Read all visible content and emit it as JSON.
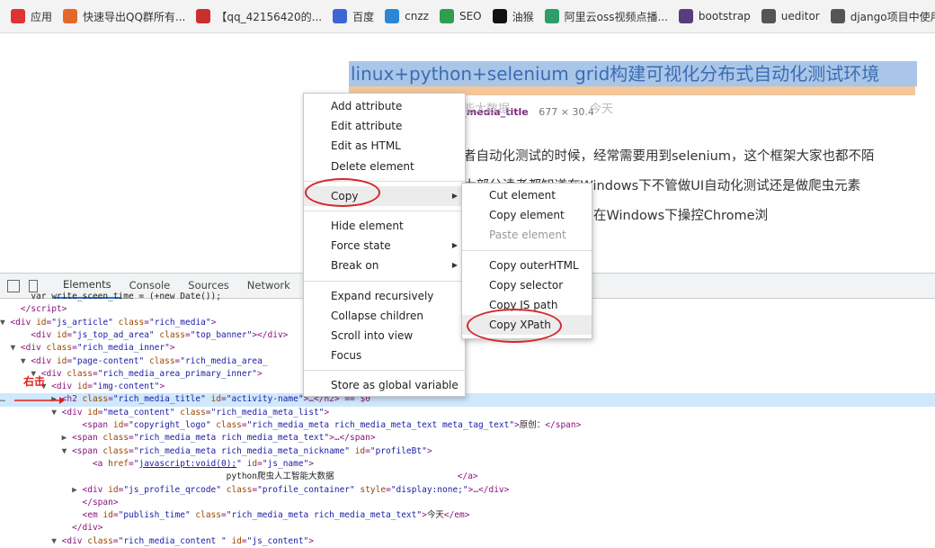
{
  "bookmarks": [
    {
      "label": "应用",
      "icon": "apps-grid-icon",
      "color": "#d33"
    },
    {
      "label": "快速导出QQ群所有...",
      "icon": "bookmark-icon",
      "color": "#e5682b"
    },
    {
      "label": "【qq_42156420的...",
      "icon": "csdn-icon",
      "color": "#c9302c"
    },
    {
      "label": "百度",
      "icon": "baidu-paw-icon",
      "color": "#3a67d4"
    },
    {
      "label": "cnzz",
      "icon": "cnzz-icon",
      "color": "#2b87d6"
    },
    {
      "label": "SEO",
      "icon": "seo-icon",
      "color": "#2e9e4f"
    },
    {
      "label": "油猴",
      "icon": "tampermonkey-icon",
      "color": "#111111"
    },
    {
      "label": "阿里云oss视频点播...",
      "icon": "aliyun-cloud-icon",
      "color": "#2c9e6a"
    },
    {
      "label": "bootstrap",
      "icon": "bootstrap-icon",
      "color": "#563d7c"
    },
    {
      "label": "ueditor",
      "icon": "ueditor-icon",
      "color": "#555555"
    },
    {
      "label": "django项目中使用...",
      "icon": "django-icon",
      "color": "#555555"
    }
  ],
  "article": {
    "title": "linux+python+selenium grid构建可视化分布式自动化测试环境",
    "nickname": "爬虫人工智能大数据",
    "publish_time": "今天",
    "tooltip_name": "h2.rich_media_title",
    "tooltip_size": "677 × 30.4",
    "paragraph_lines": [
      "者自动化测试的时候，经常需要用到selenium，这个框架大家也都不陌",
      "大部分读者都知道在Windows下不管做UI自动化测试还是做爬虫元素",
      "代码，是一个最基本的在Windows下操控Chrome浏"
    ]
  },
  "devtools": {
    "tabs": [
      "Elements",
      "Console",
      "Sources",
      "Network",
      "Pe"
    ],
    "active_tab": "Elements"
  },
  "code_lines": [
    {
      "indent": "      ",
      "tri": "",
      "html": "<span class='txt'>var write_sceen_time = (+new Date());</span>"
    },
    {
      "indent": "    ",
      "tri": "",
      "html": "&lt;/script&gt;"
    },
    {
      "indent": "  ",
      "tri": "▼",
      "html": "&lt;div <span class='attr'>id</span>=<span class='val'>\"js_article\"</span> <span class='attr'>class</span>=<span class='val'>\"rich_media\"</span>&gt;"
    },
    {
      "indent": "      ",
      "tri": "",
      "html": "&lt;div <span class='attr'>id</span>=<span class='val'>\"js_top_ad_area\"</span> <span class='attr'>class</span>=<span class='val'>\"top_banner\"</span>&gt;&lt;/div&gt;"
    },
    {
      "indent": "    ",
      "tri": "▼",
      "html": "&lt;div <span class='attr'>class</span>=<span class='val'>\"rich_media_inner\"</span>&gt;"
    },
    {
      "indent": "      ",
      "tri": "▼",
      "html": "&lt;div <span class='attr'>id</span>=<span class='val'>\"page-content\"</span> <span class='attr'>class</span>=<span class='val'>\"rich_media_area_</span>"
    },
    {
      "indent": "        ",
      "tri": "▼",
      "html": "&lt;div <span class='attr'>class</span>=<span class='val'>\"rich_media_area_primary_inner\"</span>&gt;"
    },
    {
      "indent": "          ",
      "tri": "▼",
      "html": "&lt;div <span class='attr'>id</span>=<span class='val'>\"img-content\"</span>&gt;"
    },
    {
      "indent": "            ",
      "tri": "▶",
      "html": "&lt;h2 <span class='attr'>class</span>=<span class='val'>\"rich_media_title\"</span> <span class='attr'>id</span>=<span class='val'>\"activity-name\"</span>&gt;…&lt;/h2&gt; == $0",
      "sel": true
    },
    {
      "indent": "            ",
      "tri": "▼",
      "html": "&lt;div <span class='attr'>id</span>=<span class='val'>\"meta_content\"</span> <span class='attr'>class</span>=<span class='val'>\"rich_media_meta_list\"</span>&gt;"
    },
    {
      "indent": "                ",
      "tri": "",
      "html": "&lt;span <span class='attr'>id</span>=<span class='val'>\"copyright_logo\"</span> <span class='attr'>class</span>=<span class='val'>\"rich_media_meta rich_media_meta_text meta_tag_text\"</span>&gt;<span class='txt'>原创：</span>&lt;/span&gt;"
    },
    {
      "indent": "              ",
      "tri": "▶",
      "html": "&lt;span <span class='attr'>class</span>=<span class='val'>\"rich_media_meta rich_media_meta_text\"</span>&gt;…&lt;/span&gt;"
    },
    {
      "indent": "              ",
      "tri": "▼",
      "html": "&lt;span <span class='attr'>class</span>=<span class='val'>\"rich_media_meta rich_media_meta_nickname\"</span> <span class='attr'>id</span>=<span class='val'>\"profileBt\"</span>&gt;"
    },
    {
      "indent": "                  ",
      "tri": "",
      "html": "&lt;a <span class='attr'>href</span>=<span class='val'>\"<span class='link'>javascript:void(0);</span>\"</span> <span class='attr'>id</span>=<span class='val'>\"js_name\"</span>&gt;"
    },
    {
      "indent": "                                            ",
      "tri": "",
      "html": "<span class='txt'>python爬虫人工智能大数据</span>                        &lt;/a&gt;"
    },
    {
      "indent": "                ",
      "tri": "▶",
      "html": "&lt;div <span class='attr'>id</span>=<span class='val'>\"js_profile_qrcode\"</span> <span class='attr'>class</span>=<span class='val'>\"profile_container\"</span> <span class='attr'>style</span>=<span class='val'>\"display:none;\"</span>&gt;…&lt;/div&gt;"
    },
    {
      "indent": "                ",
      "tri": "",
      "html": "&lt;/span&gt;"
    },
    {
      "indent": "                ",
      "tri": "",
      "html": "&lt;em <span class='attr'>id</span>=<span class='val'>\"publish_time\"</span> <span class='attr'>class</span>=<span class='val'>\"rich_media_meta rich_media_meta_text\"</span>&gt;<span class='txt'>今天</span>&lt;/em&gt;"
    },
    {
      "indent": "              ",
      "tri": "",
      "html": "&lt;/div&gt;"
    },
    {
      "indent": "            ",
      "tri": "▼",
      "html": "&lt;div <span class='attr'>class</span>=<span class='val'>\"rich_media_content \"</span> <span class='attr'>id</span>=<span class='val'>\"js_content\"</span>&gt;"
    }
  ],
  "annotation": {
    "right_click_label": "右击",
    "color": "#e0201c"
  },
  "context_menu": [
    {
      "label": "Add attribute"
    },
    {
      "label": "Edit attribute"
    },
    {
      "label": "Edit as HTML"
    },
    {
      "label": "Delete element"
    },
    {
      "sep": true
    },
    {
      "label": "Copy",
      "submenu": true,
      "highlight": true
    },
    {
      "sep": true
    },
    {
      "label": "Hide element"
    },
    {
      "label": "Force state",
      "submenu": true
    },
    {
      "label": "Break on",
      "submenu": true
    },
    {
      "sep": true
    },
    {
      "label": "Expand recursively"
    },
    {
      "label": "Collapse children"
    },
    {
      "label": "Scroll into view"
    },
    {
      "label": "Focus"
    },
    {
      "sep": true
    },
    {
      "label": "Store as global variable"
    }
  ],
  "copy_submenu": [
    {
      "label": "Cut element"
    },
    {
      "label": "Copy element"
    },
    {
      "label": "Paste element",
      "disabled": true
    },
    {
      "sep": true
    },
    {
      "label": "Copy outerHTML"
    },
    {
      "label": "Copy selector"
    },
    {
      "label": "Copy JS path"
    },
    {
      "label": "Copy XPath",
      "highlight": true
    }
  ]
}
